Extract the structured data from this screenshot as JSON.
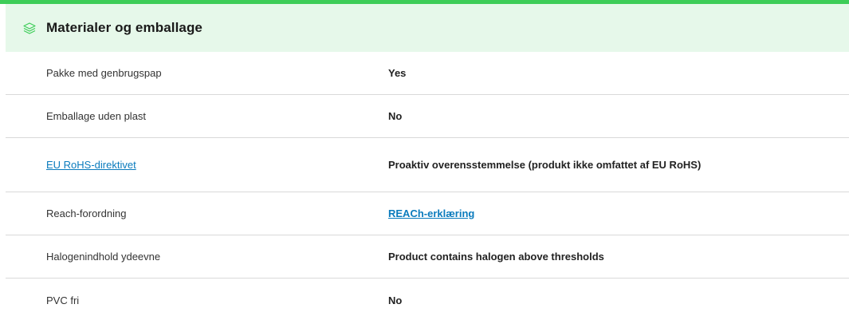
{
  "section": {
    "title": "Materialer og emballage",
    "icon": "layers-icon",
    "accent_color": "#3dcd58",
    "header_bg": "#e6f8ea"
  },
  "rows": [
    {
      "label": "Pakke med genbrugspap",
      "value": "Yes"
    },
    {
      "label": "Emballage uden plast",
      "value": "No"
    },
    {
      "label": "EU RoHS-direktivet",
      "value": "Proaktiv overensstemmelse (produkt ikke omfattet af EU RoHS)"
    },
    {
      "label": "Reach-forordning",
      "value": "REACh-erklæring"
    },
    {
      "label": "Halogenindhold ydeevne",
      "value": "Product contains halogen above thresholds"
    },
    {
      "label": "PVC fri",
      "value": "No"
    }
  ],
  "link_color": "#0a7bbd"
}
